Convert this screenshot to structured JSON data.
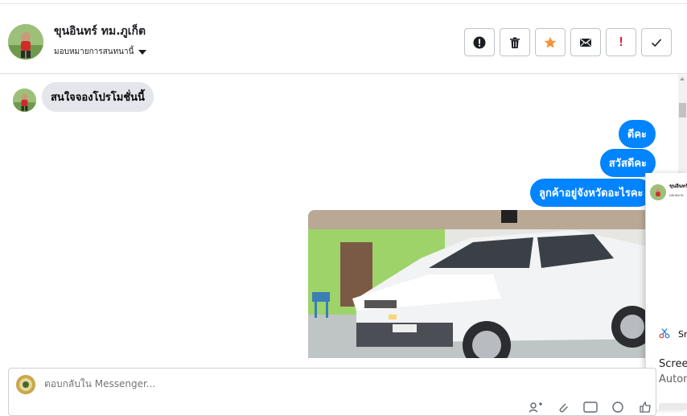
{
  "header": {
    "contact_name": "ขุนอินทร์ ทม.ภูเก็ต",
    "assign_label": "มอบหมายการสนทนานี้",
    "actions": [
      {
        "name": "report-button",
        "icon": "exclamation-circle-icon"
      },
      {
        "name": "delete-button",
        "icon": "trash-icon"
      },
      {
        "name": "star-button",
        "icon": "star-icon"
      },
      {
        "name": "mark-unread-button",
        "icon": "envelope-icon"
      },
      {
        "name": "follow-up-button",
        "icon": "exclamation-icon"
      },
      {
        "name": "mark-done-button",
        "icon": "checkmark-icon"
      }
    ]
  },
  "messages": {
    "incoming": [
      "สนใจจองโปรโมชั่นนี้"
    ],
    "outgoing": [
      "ดีคะ",
      "สวัสดีคะ",
      "ลูกค้าอยู่จังหวัดอะไรคะ"
    ],
    "attachment_icon": "car-photo"
  },
  "side_panel": {
    "mini_name": "ขุนอินทร์",
    "mini_sub": "มอบหมาย",
    "snip_label": "Sn",
    "screenshot_title": "Screen",
    "screenshot_sub": "Autom"
  },
  "composer": {
    "placeholder": "ตอบกลับใน Messenger..."
  },
  "colors": {
    "outgoing_bubble": "#0084ff",
    "incoming_bubble": "#e4e6eb",
    "star": "#f7923a",
    "alert": "#e41e3f"
  }
}
